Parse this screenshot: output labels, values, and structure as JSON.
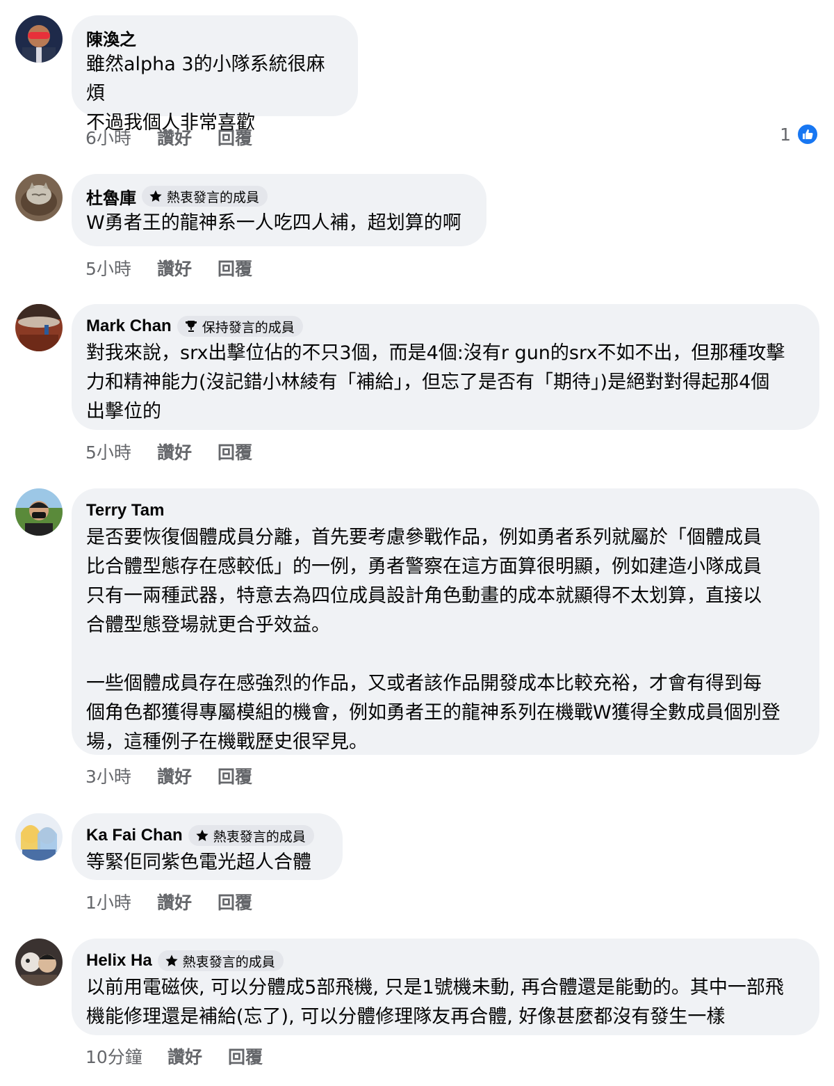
{
  "comments": [
    {
      "author": "陳渙之",
      "badge": "",
      "text": "雖然alpha 3的小隊系統很麻煩\n不過我個人非常喜歡",
      "time": "6小時",
      "like": "讚好",
      "reply": "回覆",
      "reaction_count": "1",
      "reaction_icon": "like-thumbs-up-icon"
    },
    {
      "author": "杜魯庫",
      "badge": "熱衷發言的成員",
      "badge_icon": "star-icon",
      "text": "W勇者王的龍神系一人吃四人補，超划算的啊",
      "time": "5小時",
      "like": "讚好",
      "reply": "回覆"
    },
    {
      "author": "Mark Chan",
      "badge": "保持發言的成員",
      "badge_icon": "trophy-icon",
      "text": "對我來說，srx出擊位佔的不只3個，而是4個:沒有r gun的srx不如不出，但那種攻擊\n力和精神能力(沒記錯小林綾有「補給」，但忘了是否有「期待」)是絕對對得起那4個\n出擊位的",
      "time": "5小時",
      "like": "讚好",
      "reply": "回覆"
    },
    {
      "author": "Terry Tam",
      "badge": "",
      "text": "是否要恢復個體成員分離，首先要考慮參戰作品，例如勇者系列就屬於「個體成員\n比合體型態存在感較低」的一例，勇者警察在這方面算很明顯，例如建造小隊成員\n只有一兩種武器，特意去為四位成員設計角色動畫的成本就顯得不太划算，直接以\n合體型態登場就更合乎效益。\n\n一些個體成員存在感強烈的作品，又或者該作品開發成本比較充裕，才會有得到每\n個角色都獲得專屬模組的機會，例如勇者王的龍神系列在機戰W獲得全數成員個別登\n場，這種例子在機戰歷史很罕見。",
      "time": "3小時",
      "like": "讚好",
      "reply": "回覆"
    },
    {
      "author": "Ka Fai Chan",
      "badge": "熱衷發言的成員",
      "badge_icon": "star-icon",
      "text": "等緊佢同紫色電光超人合體",
      "time": "1小時",
      "like": "讚好",
      "reply": "回覆"
    },
    {
      "author": "Helix Ha",
      "badge": "熱衷發言的成員",
      "badge_icon": "star-icon",
      "text": "以前用電磁俠, 可以分體成5部飛機, 只是1號機未動, 再合體還是能動的。其中一部飛\n機能修理還是補給(忘了), 可以分體修理隊友再合體, 好像甚麼都沒有發生一樣",
      "time": "10分鐘",
      "like": "讚好",
      "reply": "回覆"
    }
  ],
  "colors": {
    "bubble": "#f0f2f5",
    "badge": "#e4e6eb",
    "meta_text": "#65676b",
    "like_blue": "#1877f2"
  }
}
